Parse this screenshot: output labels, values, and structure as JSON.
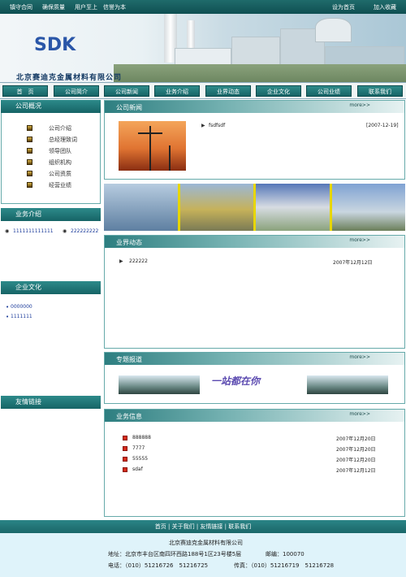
{
  "topbar": {
    "links": [
      "镇守合同",
      "确保质量",
      "用户至上",
      "信誉为本"
    ],
    "set_home": "设为首页",
    "favorite": "加入收藏"
  },
  "banner": {
    "logo_text": "SDK",
    "company_name": "北京赛迪克金属材料有限公司"
  },
  "nav": {
    "items": [
      "首　页",
      "公司简介",
      "公司新闻",
      "业务介绍",
      "业界动态",
      "企业文化",
      "公司业绩",
      "联系我们"
    ]
  },
  "left": {
    "overview": {
      "title": "公司概况",
      "items": [
        "公司介绍",
        "总经理致词",
        "领导团队",
        "组织机构",
        "公司资质",
        "经营业绩"
      ]
    },
    "business": {
      "title": "业务介绍",
      "items": [
        "1111111111111",
        "222222222"
      ]
    },
    "culture": {
      "title": "企业文化",
      "items": [
        "0000000",
        "1111111"
      ]
    },
    "links": {
      "title": "友情链接"
    }
  },
  "news": {
    "title": "公司新闻",
    "more": "more>>",
    "items": [
      {
        "text": "fsdfsdf",
        "date": "[2007-12-19]"
      }
    ]
  },
  "industry": {
    "title": "业界动态",
    "more": "more>>",
    "items": [
      {
        "text": "222222",
        "date": "2007年12月12日"
      }
    ]
  },
  "special": {
    "title": "专题报道",
    "more": "more>>",
    "logo_text": "一站都在你"
  },
  "business_info": {
    "title": "业务信息",
    "more": "more>>",
    "items": [
      {
        "text": "888888",
        "date": "2007年12月20日"
      },
      {
        "text": "7777",
        "date": "2007年12月20日"
      },
      {
        "text": "55555",
        "date": "2007年12月20日"
      },
      {
        "text": "sdaf",
        "date": "2007年12月12日"
      }
    ]
  },
  "footer": {
    "nav": "首页 | 关于我们 | 友情链接 | 联系我们",
    "company": "北京赛迪克金属材料有限公司",
    "address": "地址：北京市丰台区南四环西路188号1区23号楼5层",
    "postcode": "邮编：100070",
    "phone": "电话：（010）51216726　51216725",
    "fax": "传真：（010）51216719　51216728"
  },
  "colors": {
    "teal": "#166466",
    "bullet_red": "#d42a1a",
    "link_blue": "#1a3a9a"
  }
}
